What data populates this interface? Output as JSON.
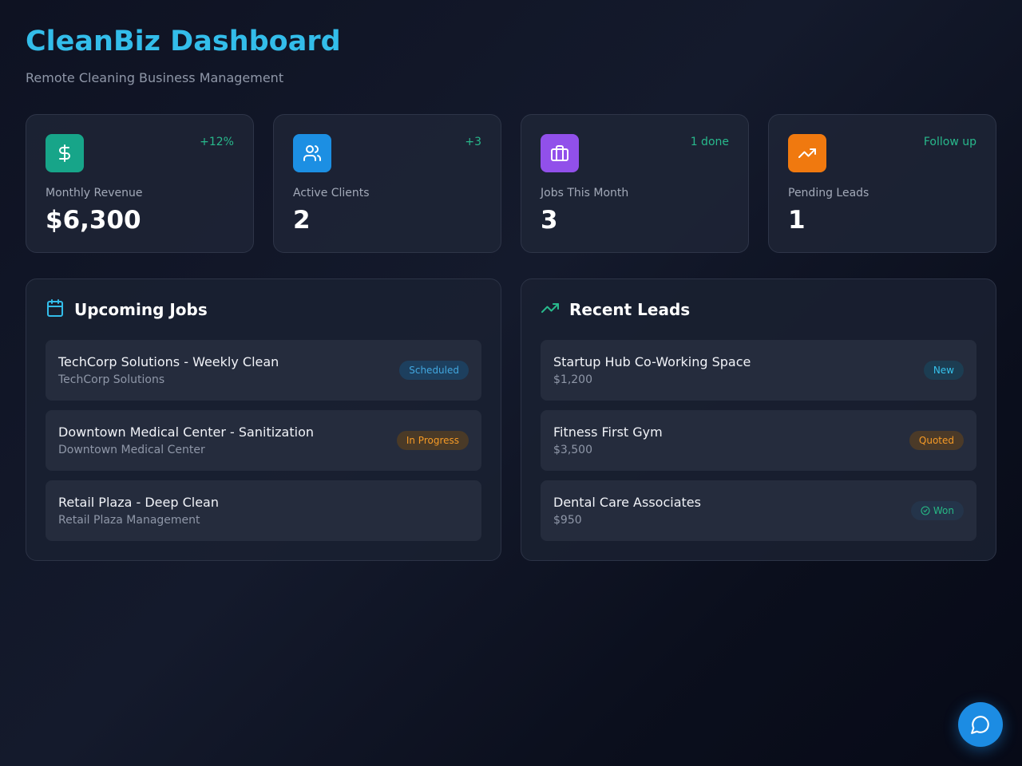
{
  "header": {
    "title": "CleanBiz Dashboard",
    "subtitle": "Remote Cleaning Business Management"
  },
  "stats": [
    {
      "icon": "dollar-icon",
      "color": "#17a589",
      "change": "+12%",
      "label": "Monthly Revenue",
      "value": "$6,300"
    },
    {
      "icon": "users-icon",
      "color": "#1c8fe3",
      "change": "+3",
      "label": "Active Clients",
      "value": "2"
    },
    {
      "icon": "briefcase-icon",
      "color": "#9150ea",
      "change": "1 done",
      "label": "Jobs This Month",
      "value": "3"
    },
    {
      "icon": "trending-up-icon",
      "color": "#f0790f",
      "change": "Follow up",
      "label": "Pending Leads",
      "value": "1"
    }
  ],
  "jobs_panel": {
    "title": "Upcoming Jobs",
    "icon": "calendar-icon",
    "items": [
      {
        "title": "TechCorp Solutions - Weekly Clean",
        "sub": "TechCorp Solutions",
        "status": "Scheduled"
      },
      {
        "title": "Downtown Medical Center - Sanitization",
        "sub": "Downtown Medical Center",
        "status": "In Progress"
      },
      {
        "title": "Retail Plaza - Deep Clean",
        "sub": "Retail Plaza Management",
        "status": ""
      }
    ]
  },
  "leads_panel": {
    "title": "Recent Leads",
    "icon": "trending-up-icon",
    "items": [
      {
        "title": "Startup Hub Co-Working Space",
        "sub": "$1,200",
        "status": "New"
      },
      {
        "title": "Fitness First Gym",
        "sub": "$3,500",
        "status": "Quoted"
      },
      {
        "title": "Dental Care Associates",
        "sub": "$950",
        "status": "Won"
      }
    ]
  },
  "colors": {
    "accent": "#33bdea",
    "positive": "#28b98c",
    "chat_button": "#1c8ce3"
  },
  "chat_button": {
    "icon": "chat-bubble-icon"
  }
}
